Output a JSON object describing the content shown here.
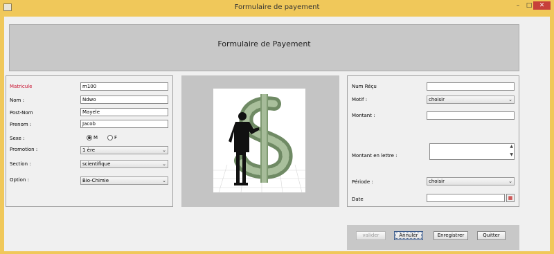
{
  "window": {
    "title": "Formulaire de payement",
    "minimize": "–",
    "maximize": "□",
    "close": "✕"
  },
  "header": {
    "title": "Formulaire de Payement"
  },
  "left_form": {
    "matricule": {
      "label": "Matricule",
      "value": "m100"
    },
    "nom": {
      "label": "Nom :",
      "value": "Ndwo"
    },
    "post_nom": {
      "label": "Post-Nom",
      "value": "Mayele"
    },
    "prenom": {
      "label": "Prenom :",
      "value": "Jacob"
    },
    "sexe": {
      "label": "Sexe :",
      "option_m": "M",
      "option_f": "F",
      "selected": "M"
    },
    "promotion": {
      "label": "Promotion :",
      "value": "1 ère"
    },
    "section": {
      "label": "Section :",
      "value": "scientifique"
    },
    "option": {
      "label": "Option :",
      "value": "Bio-Chimie"
    }
  },
  "right_form": {
    "num_recu": {
      "label": "Num Réçu",
      "value": ""
    },
    "motif": {
      "label": "Motif :",
      "value": "choisir"
    },
    "montant": {
      "label": "Montant :",
      "value": ""
    },
    "montant_lettre": {
      "label": "Montant en lettre :",
      "value": ""
    },
    "periode": {
      "label": "Période :",
      "value": "choisir"
    },
    "date": {
      "label": "Date",
      "value": ""
    }
  },
  "buttons": {
    "valider": "valider",
    "annuler": "Annuler",
    "enregistrer": "Enregistrer",
    "quitter": "Quitter"
  },
  "colors": {
    "titlebar": "#f0c85a",
    "close_button": "#c7403a",
    "required_label": "#c8102e",
    "header_panel": "#c8c8c8"
  },
  "icons": {
    "app": "java-window-icon",
    "date_picker": "calendar-icon",
    "image": "businessman-dollar-sign-image"
  }
}
